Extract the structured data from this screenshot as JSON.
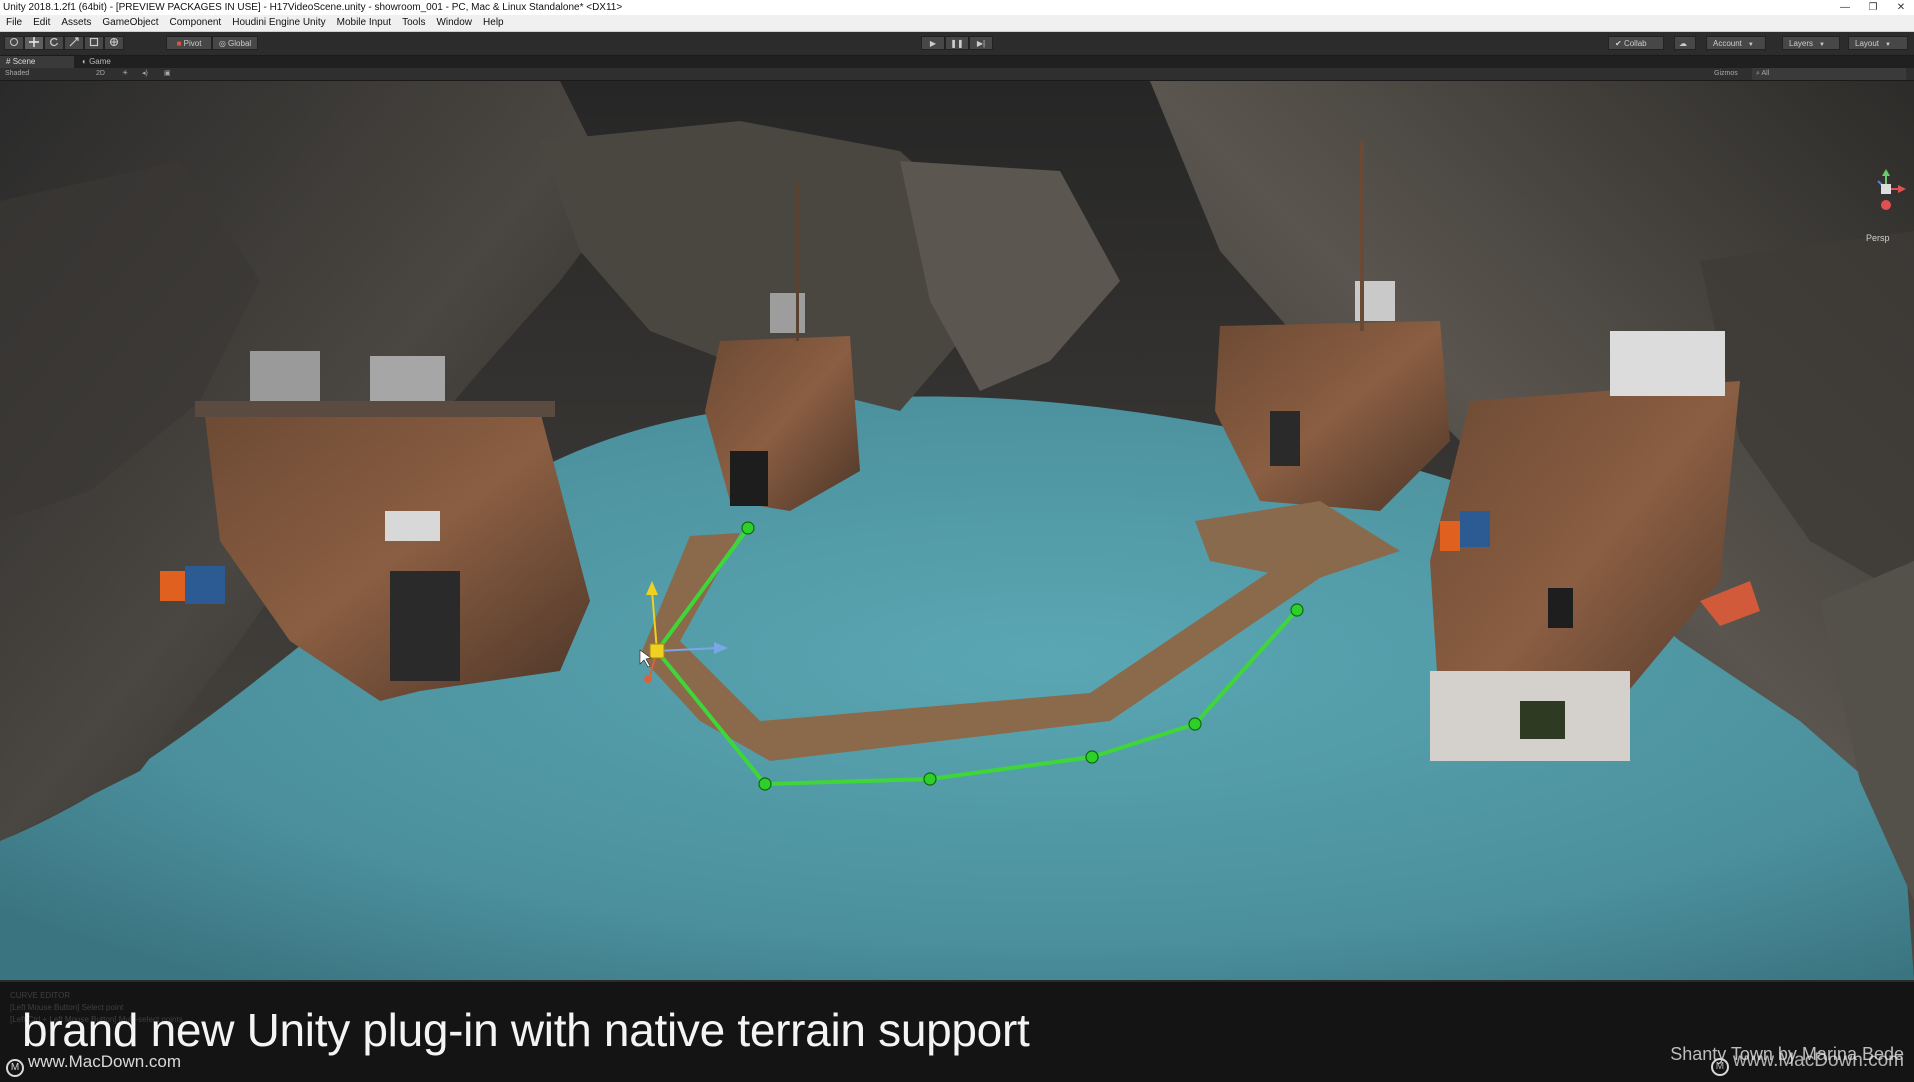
{
  "window": {
    "title": "Unity 2018.1.2f1 (64bit) - [PREVIEW PACKAGES IN USE] - H17VideoScene.unity - showroom_001 - PC, Mac & Linux Standalone* <DX11>",
    "minimize_glyph": "—",
    "restore_glyph": "❐",
    "close_glyph": "✕"
  },
  "menu": [
    "File",
    "Edit",
    "Assets",
    "GameObject",
    "Component",
    "Houdini Engine Unity",
    "Mobile Input",
    "Tools",
    "Window",
    "Help"
  ],
  "toolbar": {
    "tools": [
      "hand-icon",
      "move-icon",
      "rotate-icon",
      "scale-icon",
      "rect-icon",
      "transform-icon"
    ],
    "pivot_label": "Pivot",
    "global_label": "Global",
    "play_glyph": "▶",
    "pause_glyph": "❚❚",
    "step_glyph": "▶|",
    "collab_label": "Collab",
    "account_label": "Account",
    "layers_label": "Layers",
    "layout_label": "Layout"
  },
  "tabs": {
    "scene": "Scene",
    "game": "Game"
  },
  "scene_bar": {
    "shading": "Shaded",
    "mode_2d": "2D",
    "gizmos": "Gizmos",
    "search": "All"
  },
  "gizmo": {
    "persp_label": "Persp"
  },
  "colors": {
    "path": "#3fd63a",
    "water": "#4f9aa8",
    "handle": "#f0d020"
  },
  "console_lines": [
    "CURVE EDITOR",
    "[Left Mouse Button] Select point",
    "[Left Ctrl + Left Mouse Button] Multi-select points"
  ],
  "caption": "brand new Unity plug-in with native terrain support",
  "credit": "Shanty Town by Marina Bede",
  "watermark_left": "www.MacDown.com",
  "watermark_right": "www.MacDown.com"
}
